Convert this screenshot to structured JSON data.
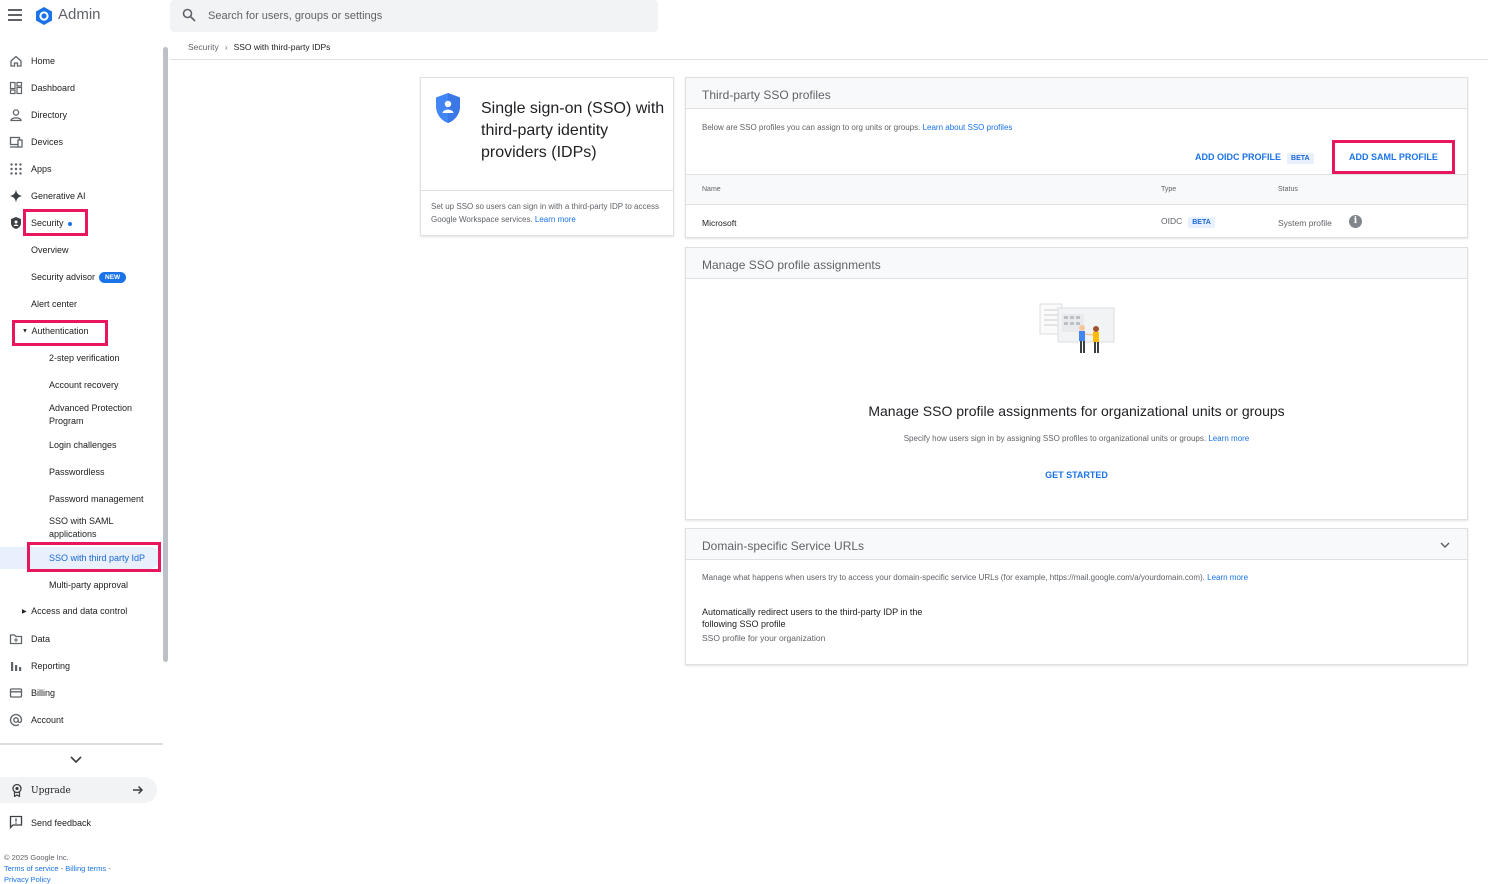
{
  "app": {
    "title": "Admin"
  },
  "search": {
    "placeholder": "Search for users, groups or settings"
  },
  "breadcrumb": {
    "parent": "Security",
    "current": "SSO with third-party IDPs"
  },
  "sidebar": {
    "items": [
      {
        "label": "Home",
        "icon": "home-icon"
      },
      {
        "label": "Dashboard",
        "icon": "dashboard-icon"
      },
      {
        "label": "Directory",
        "icon": "person-icon"
      },
      {
        "label": "Devices",
        "icon": "devices-icon"
      },
      {
        "label": "Apps",
        "icon": "apps-grid-icon"
      },
      {
        "label": "Generative AI",
        "icon": "sparkle-icon"
      },
      {
        "label": "Security",
        "icon": "shield-icon"
      }
    ],
    "security_sub": {
      "overview": "Overview",
      "advisor": "Security advisor",
      "advisor_badge": "NEW",
      "alert_center": "Alert center",
      "authentication": "Authentication"
    },
    "auth_sub": {
      "two_step": "2-step verification",
      "account_recovery": "Account recovery",
      "advanced_protection": "Advanced Protection Program",
      "login_challenges": "Login challenges",
      "passwordless": "Passwordless",
      "password_mgmt": "Password management",
      "sso_saml_apps": "SSO with SAML applications",
      "sso_third_party": "SSO with third party IdP",
      "multi_party": "Multi-party approval"
    },
    "access_data_control": "Access and data control",
    "bottom_items": [
      {
        "label": "Data",
        "icon": "data-folder-icon"
      },
      {
        "label": "Reporting",
        "icon": "bar-chart-icon"
      },
      {
        "label": "Billing",
        "icon": "credit-card-icon"
      },
      {
        "label": "Account",
        "icon": "at-sign-icon"
      }
    ],
    "upgrade": "Upgrade",
    "feedback": "Send feedback"
  },
  "footer": {
    "copyright": "© 2025 Google Inc.",
    "terms": "Terms of service",
    "billing_terms": "Billing terms",
    "privacy": "Privacy Policy"
  },
  "intro_card": {
    "title": "Single sign-on (SSO) with third-party identity providers (IDPs)",
    "description": "Set up SSO so users can sign in with a third-party IDP to access Google Workspace services.",
    "learn_more": "Learn more"
  },
  "profiles_card": {
    "title": "Third-party SSO profiles",
    "description": "Below are SSO profiles you can assign to org units or groups.",
    "learn_link": "Learn about SSO profiles",
    "add_oidc": "ADD OIDC PROFILE",
    "oidc_badge": "BETA",
    "add_saml": "ADD SAML PROFILE",
    "columns": {
      "name": "Name",
      "type": "Type",
      "status": "Status"
    },
    "rows": [
      {
        "name": "Microsoft",
        "type": "OIDC",
        "type_badge": "BETA",
        "status": "System profile",
        "info": "i"
      }
    ]
  },
  "assign_card": {
    "title": "Manage SSO profile assignments",
    "heading": "Manage SSO profile assignments for organizational units or groups",
    "description": "Specify how users sign in by assigning SSO profiles to organizational units or groups.",
    "learn_more": "Learn more",
    "get_started": "GET STARTED"
  },
  "domain_card": {
    "title": "Domain-specific Service URLs",
    "description": "Manage what happens when users try to access your domain-specific service URLs (for example, https://mail.google.com/a/yourdomain.com).",
    "learn_more": "Learn more",
    "setting_label": "Automatically redirect users to the third-party IDP in the following SSO profile",
    "setting_value": "SSO profile for your organization"
  },
  "colors": {
    "accent": "#1a73e8",
    "highlight": "#e8175d",
    "header_bg": "#f8f9fa"
  }
}
